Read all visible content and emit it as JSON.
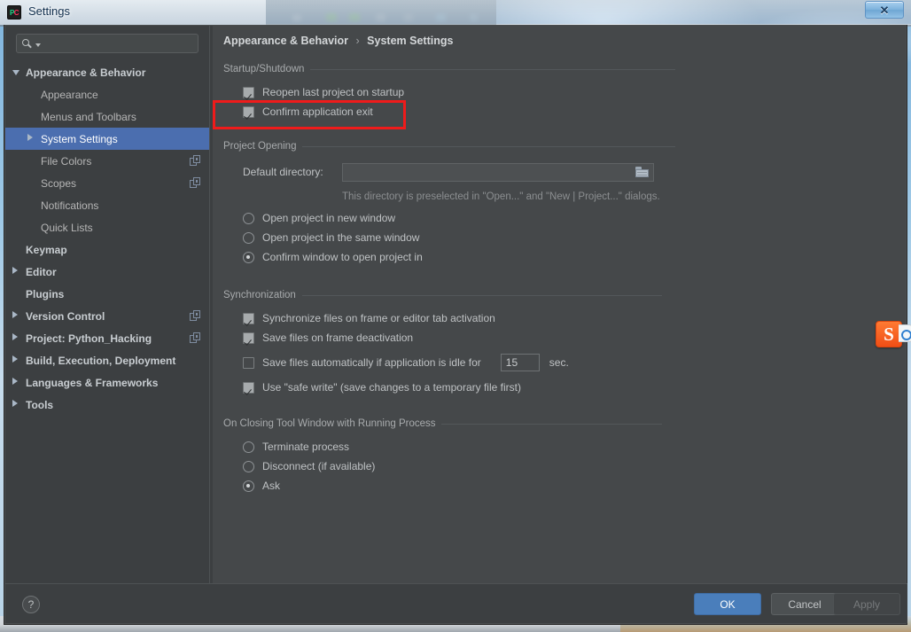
{
  "window": {
    "title": "Settings",
    "app_icon": "pycharm-icon",
    "close_label": "✕"
  },
  "sidebar": {
    "search": {
      "value": "",
      "placeholder": ""
    },
    "items": [
      {
        "label": "Appearance & Behavior",
        "level": 0,
        "twisty": "open",
        "selected": false,
        "copy_icon": false
      },
      {
        "label": "Appearance",
        "level": 1,
        "twisty": "none",
        "selected": false,
        "copy_icon": false
      },
      {
        "label": "Menus and Toolbars",
        "level": 1,
        "twisty": "none",
        "selected": false,
        "copy_icon": false
      },
      {
        "label": "System Settings",
        "level": 1,
        "twisty": "closed",
        "selected": true,
        "copy_icon": false
      },
      {
        "label": "File Colors",
        "level": 1,
        "twisty": "none",
        "selected": false,
        "copy_icon": true
      },
      {
        "label": "Scopes",
        "level": 1,
        "twisty": "none",
        "selected": false,
        "copy_icon": true
      },
      {
        "label": "Notifications",
        "level": 1,
        "twisty": "none",
        "selected": false,
        "copy_icon": false
      },
      {
        "label": "Quick Lists",
        "level": 1,
        "twisty": "none",
        "selected": false,
        "copy_icon": false
      },
      {
        "label": "Keymap",
        "level": 0,
        "twisty": "none",
        "selected": false,
        "copy_icon": false
      },
      {
        "label": "Editor",
        "level": 0,
        "twisty": "closed",
        "selected": false,
        "copy_icon": false
      },
      {
        "label": "Plugins",
        "level": 0,
        "twisty": "none",
        "selected": false,
        "copy_icon": false
      },
      {
        "label": "Version Control",
        "level": 0,
        "twisty": "closed",
        "selected": false,
        "copy_icon": true
      },
      {
        "label": "Project: Python_Hacking",
        "level": 0,
        "twisty": "closed",
        "selected": false,
        "copy_icon": true
      },
      {
        "label": "Build, Execution, Deployment",
        "level": 0,
        "twisty": "closed",
        "selected": false,
        "copy_icon": false
      },
      {
        "label": "Languages & Frameworks",
        "level": 0,
        "twisty": "closed",
        "selected": false,
        "copy_icon": false
      },
      {
        "label": "Tools",
        "level": 0,
        "twisty": "closed",
        "selected": false,
        "copy_icon": false
      }
    ]
  },
  "content": {
    "breadcrumb": {
      "parent": "Appearance & Behavior",
      "separator": "›",
      "current": "System Settings"
    },
    "startup": {
      "title": "Startup/Shutdown",
      "reopen_label": "Reopen last project on startup",
      "reopen_checked": true,
      "confirm_exit_label": "Confirm application exit",
      "confirm_exit_checked": true
    },
    "project_opening": {
      "title": "Project Opening",
      "dir_label": "Default directory:",
      "dir_value": "",
      "dir_placeholder": "",
      "dir_hint": "This directory is preselected in \"Open...\" and \"New | Project...\" dialogs.",
      "options": [
        {
          "label": "Open project in new window",
          "selected": false
        },
        {
          "label": "Open project in the same window",
          "selected": false
        },
        {
          "label": "Confirm window to open project in",
          "selected": true
        }
      ]
    },
    "synchronization": {
      "title": "Synchronization",
      "options": [
        {
          "label": "Synchronize files on frame or editor tab activation",
          "checked": true
        },
        {
          "label": "Save files on frame deactivation",
          "checked": true
        },
        {
          "label": "Save files automatically if application is idle for",
          "checked": false
        },
        {
          "label": "Use \"safe write\" (save changes to a temporary file first)",
          "checked": true
        }
      ],
      "idle_value": "15",
      "idle_unit": "sec."
    },
    "closing_tool_window": {
      "title": "On Closing Tool Window with Running Process",
      "options": [
        {
          "label": "Terminate process",
          "selected": false
        },
        {
          "label": "Disconnect (if available)",
          "selected": false
        },
        {
          "label": "Ask",
          "selected": true
        }
      ]
    }
  },
  "footer": {
    "help_label": "?",
    "ok_label": "OK",
    "cancel_label": "Cancel",
    "apply_label": "Apply"
  },
  "overlay": {
    "annotation_color": "#ef1b1b",
    "ime_icon_label": "S"
  },
  "colors": {
    "accent": "#4b6eaf",
    "panel": "#3c3f41",
    "content": "#45484a",
    "text": "#bfc2c4",
    "annotation": "#ef1b1b"
  }
}
